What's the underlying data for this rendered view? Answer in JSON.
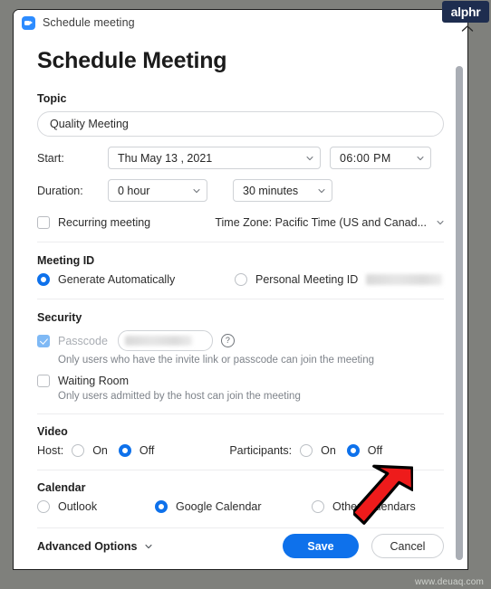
{
  "window": {
    "titlebar_text": "Schedule meeting",
    "app_icon": "zoom-camera-icon",
    "minimize_icon": "chevron-up-icon"
  },
  "branding": {
    "badge_text": "alphr",
    "watermark_text": "www.deuaq.com"
  },
  "page": {
    "title": "Schedule Meeting"
  },
  "topic": {
    "label": "Topic",
    "value": "Quality Meeting"
  },
  "start": {
    "label": "Start:",
    "date_value": "Thu  May  13 , 2021",
    "time_value": "06:00  PM"
  },
  "duration": {
    "label": "Duration:",
    "hour_value": "0 hour",
    "minute_value": "30 minutes"
  },
  "recurring": {
    "label": "Recurring meeting",
    "checked": false
  },
  "timezone": {
    "label": "Time Zone: Pacific Time (US and Canad..."
  },
  "meeting_id": {
    "section_label": "Meeting ID",
    "option_generate": "Generate Automatically",
    "option_personal": "Personal Meeting ID",
    "personal_id_value": "",
    "selected": "generate"
  },
  "security": {
    "section_label": "Security",
    "passcode_label": "Passcode",
    "passcode_value": "",
    "passcode_checked": true,
    "passcode_help_icon": "question-mark-icon",
    "passcode_helper": "Only users who have the invite link or passcode can join the meeting",
    "waiting_room_label": "Waiting Room",
    "waiting_room_checked": false,
    "waiting_room_helper": "Only users admitted by the host can join the meeting"
  },
  "video": {
    "section_label": "Video",
    "host_label": "Host:",
    "host_on": "On",
    "host_off": "Off",
    "host_selected": "off",
    "participants_label": "Participants:",
    "participants_on": "On",
    "participants_off": "Off",
    "participants_selected": "off"
  },
  "calendar": {
    "section_label": "Calendar",
    "option_outlook": "Outlook",
    "option_google": "Google Calendar",
    "option_other": "Other Calendars",
    "selected": "google"
  },
  "advanced": {
    "label": "Advanced Options",
    "icon": "chevron-down-icon",
    "expanded": false
  },
  "footer": {
    "save_label": "Save",
    "cancel_label": "Cancel"
  },
  "annotation": {
    "arrow": "red-down-left-arrow"
  },
  "colors": {
    "accent_blue": "#0e71eb",
    "zoom_icon_blue": "#2d8cff",
    "disabled_check_blue": "#7fb9f5",
    "badge_navy": "#1e2d4f",
    "arrow_red": "#ee1b1b",
    "frame_gray": "#7f807c"
  }
}
